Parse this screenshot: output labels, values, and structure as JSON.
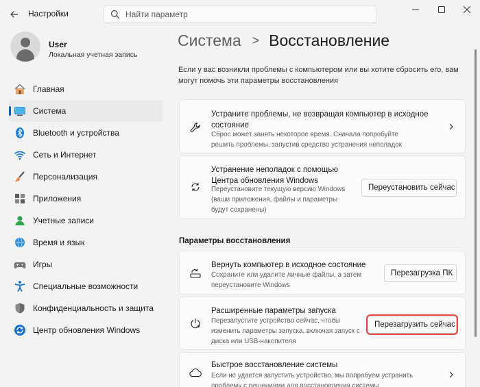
{
  "window": {
    "title": "Настройки",
    "search_placeholder": "Найти параметр"
  },
  "user": {
    "name": "User",
    "account_type": "Локальная учетная запись"
  },
  "sidebar": {
    "items": [
      {
        "label": "Главная",
        "icon": "home-icon"
      },
      {
        "label": "Система",
        "icon": "system-icon",
        "active": true
      },
      {
        "label": "Bluetooth и устройства",
        "icon": "bluetooth-icon"
      },
      {
        "label": "Сеть и Интернет",
        "icon": "wifi-icon"
      },
      {
        "label": "Персонализация",
        "icon": "brush-icon"
      },
      {
        "label": "Приложения",
        "icon": "apps-icon"
      },
      {
        "label": "Учетные записи",
        "icon": "accounts-icon"
      },
      {
        "label": "Время и язык",
        "icon": "globe-icon"
      },
      {
        "label": "Игры",
        "icon": "gamepad-icon"
      },
      {
        "label": "Специальные возможности",
        "icon": "accessibility-icon"
      },
      {
        "label": "Конфиденциальность и защита",
        "icon": "shield-icon"
      },
      {
        "label": "Центр обновления Windows",
        "icon": "update-icon"
      }
    ]
  },
  "breadcrumb": {
    "parent": "Система",
    "separator": ">",
    "current": "Восстановление"
  },
  "intro": "Если у вас возникли проблемы с компьютером или вы хотите сбросить его, вам могут помочь эти параметры восстановления",
  "cards": {
    "fix_problems": {
      "title": "Устраните проблемы, не возвращая компьютер в исходное состояние",
      "description": "Сброс может занять некоторое время. Сначала попробуйте решить проблемы, запустив средство устранения неполадок"
    },
    "windows_update_fix": {
      "title": "Устранение неполадок с помощью Центра обновления Windows",
      "description": "Переустановите текущую версию Windows (ваши приложения, файлы и параметры будут сохранены)",
      "button": "Переустановить сейчас"
    }
  },
  "recovery_section": {
    "title": "Параметры восстановления",
    "reset_pc": {
      "title": "Вернуть компьютер в исходное состояние",
      "description": "Сохраните или удалите личные файлы, а затем переустановите Windows",
      "button": "Перезагрузка ПК"
    },
    "advanced_startup": {
      "title": "Расширенные параметры запуска",
      "description": "Перезапустите устройство сейчас, чтобы изменить параметры запуска, включая запуск с диска или USB-накопителя",
      "button": "Перезагрузить сейчас"
    },
    "quick_recovery": {
      "title": "Быстрое восстановление системы",
      "description": "Если не удается запустить устройство, мы попробуем устранить проблему с решениями для восстановления системы"
    }
  },
  "colors": {
    "accent": "#0067c0",
    "highlight_border": "#e8463f",
    "background": "#f3f3f3",
    "card": "#fbfbfb"
  }
}
